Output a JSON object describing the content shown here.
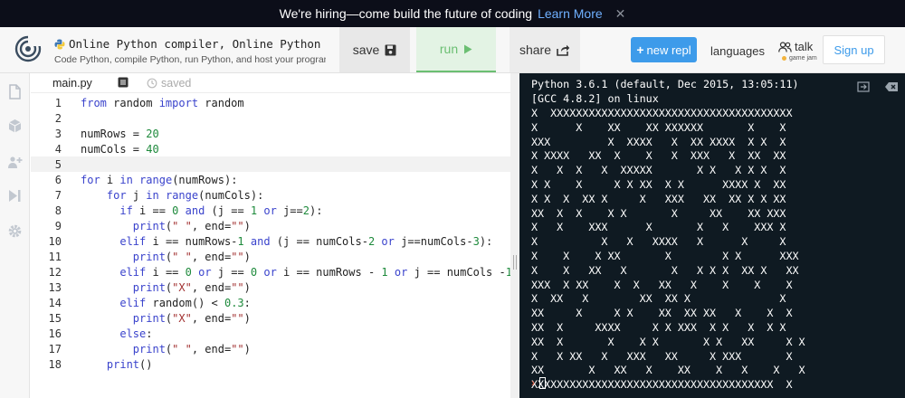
{
  "banner": {
    "message": "We're hiring—come build the future of coding",
    "link": "Learn More",
    "close": "✕"
  },
  "header": {
    "title": "Online Python compiler, Online Python ID...",
    "subtitle": "Code Python, compile Python, run Python, and host your programs ...",
    "save_label": "save",
    "run_label": "run",
    "share_label": "share",
    "new_repl_label": "new repl",
    "languages_label": "languages",
    "talk_label": "talk",
    "talk_sub": "game jam",
    "signup_label": "Sign up"
  },
  "tabs": {
    "file_name": "main.py",
    "saved_label": "saved"
  },
  "editor": {
    "active_line": 6,
    "line_numbers": [
      "1",
      "2",
      "3",
      "4",
      "5",
      "6",
      "7",
      "8",
      "9",
      "10",
      "11",
      "12",
      "13",
      "14",
      "15",
      "16",
      "17",
      "18"
    ]
  },
  "console": {
    "header_lines": [
      "Python 3.6.1 (default, Dec 2015, 13:05:11)",
      "[GCC 4.8.2] on linux"
    ],
    "output_lines": [
      "X  XXXXXXXXXXXXXXXXXXXXXXXXXXXXXXXXXXXXXX",
      "X      X    XX    XX XXXXXX       X    X",
      "XXX         X  XXXX   X  XX XXXX  X X  X",
      "X XXXX   XX  X    X   X  XXX   X  XX  XX",
      "X   X  X   X  XXXXX       X X   X X X  X",
      "X X    X     X X XX  X X      XXXX X  XX",
      "X X  X  XX X     X   XXX   XX  XX X X XX",
      "XX  X  X    X X       X     XX    XX XXX",
      "X   X    XXX      X       X   X    XXX X",
      "X          X   X   XXXX   X      X     X",
      "X    X    X XX       X        X X      XXX",
      "X    X   XX   X       X   X X X  XX X   XX",
      "XXX  X XX    X  X   XX   X    X    X    X",
      "X  XX   X        XX  XX X              X",
      "XX     X     X X    XX  XX XX   X    X  X",
      "XX  X     XXXX     X X XXX  X X   X  X X",
      "XX  X       X    X X       X X   XX     X X",
      "X   X XX   X   XXX   XX     X XXX       X",
      "XX       X   XX   X    XX    X   X    X   X",
      "XXXXXXXXXXXXXXXXXXXXXXXXXXXXXXXXXXXXXX  X"
    ],
    "prompt_symbol": "›"
  },
  "colors": {
    "accent_blue": "#3d9bea",
    "run_green": "#6bbf72",
    "console_bg": "#0f1a22",
    "keyword": "#3a43cc",
    "number": "#1e8a3c",
    "string": "#a23131"
  }
}
